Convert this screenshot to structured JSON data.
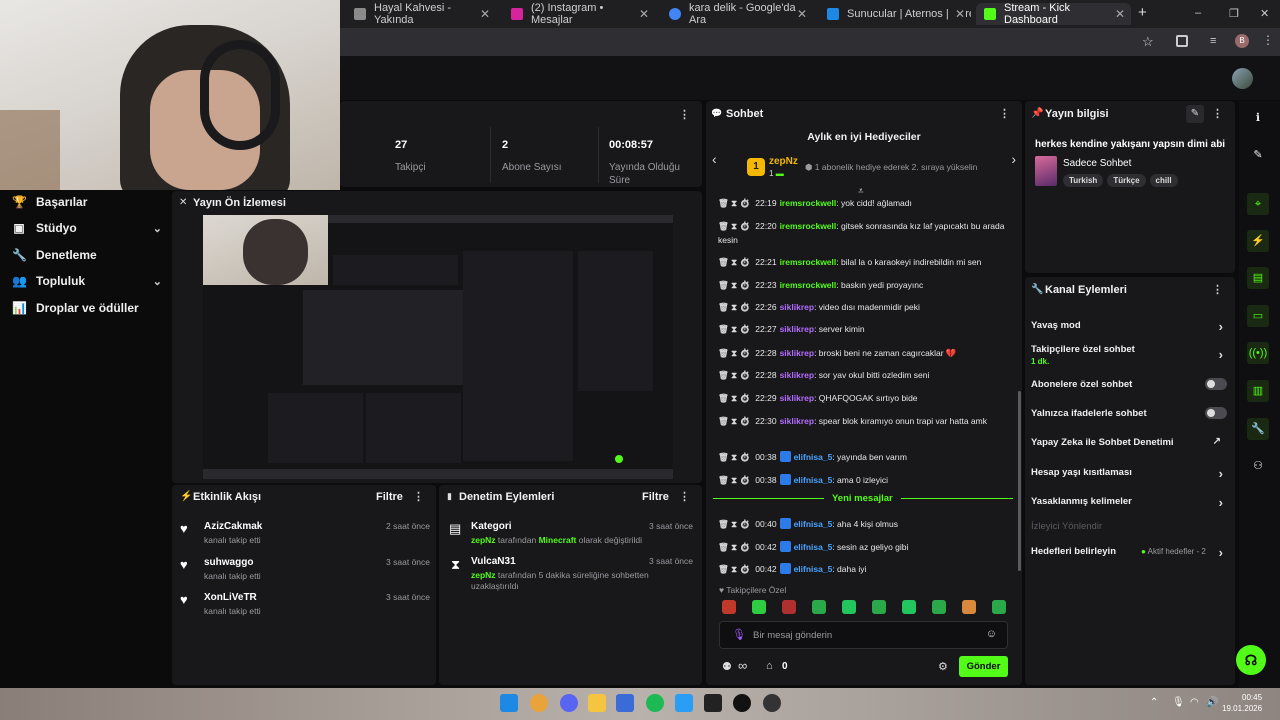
{
  "browser": {
    "tabs": [
      {
        "label": "Hayal Kahvesi - Yakında",
        "color": "#8a8a8a"
      },
      {
        "label": "(2) Instagram • Mesajlar",
        "color": "#d6249f"
      },
      {
        "label": "kara delik - Google'da Ara",
        "color": "#4285f4"
      },
      {
        "label": "Sunucular | Aternos | Ücretsiz M",
        "color": "#1e88e5"
      },
      {
        "label": "Stream - Kick Dashboard",
        "color": "#53fc18"
      }
    ],
    "new_tab": "+",
    "window_controls": [
      "–",
      "❐",
      "✕"
    ],
    "profile_initial": "B"
  },
  "sidebar": {
    "items": [
      {
        "label": "Başarılar",
        "icon": "trophy-icon",
        "glyph": "🏆",
        "chevron": false
      },
      {
        "label": "Stüdyo",
        "icon": "studio-icon",
        "glyph": "▣",
        "chevron": true
      },
      {
        "label": "Denetleme",
        "icon": "wrench-icon",
        "glyph": "🔧",
        "chevron": false
      },
      {
        "label": "Topluluk",
        "icon": "community-icon",
        "glyph": "👥",
        "chevron": true
      },
      {
        "label": "Droplar ve ödüller",
        "icon": "drops-icon",
        "glyph": "📊",
        "chevron": false
      }
    ]
  },
  "stats": [
    {
      "value": "27",
      "label": "Takipçi"
    },
    {
      "value": "2",
      "label": "Abone Sayısı"
    },
    {
      "value": "00:08:57",
      "label": "Yayında Olduğu Süre"
    }
  ],
  "preview": {
    "title": "Yayın Ön İzlemesi"
  },
  "activity": {
    "title": "Etkinlik Akışı",
    "filter": "Filtre",
    "items": [
      {
        "name": "AzizCakmak",
        "sub": "kanalı takip etti",
        "time": "2 saat önce"
      },
      {
        "name": "suhwaggo",
        "sub": "kanalı takip etti",
        "time": "3 saat önce"
      },
      {
        "name": "XonLiVeTR",
        "sub": "kanalı takip etti",
        "time": "3 saat önce"
      }
    ]
  },
  "moderation": {
    "title": "Denetim Eylemleri",
    "filter": "Filtre",
    "items": [
      {
        "name": "Kategori",
        "time": "3 saat önce",
        "by": "zepNz",
        "mid": " tarafından ",
        "hl": "Minecraft",
        "rest": " olarak değiştirildi"
      },
      {
        "name": "VulcaN31",
        "time": "3 saat önce",
        "by": "zepNz",
        "mid": " tarafından 5 dakika süreliğine sohbetten uzaklaştırıldı",
        "hl": "",
        "rest": ""
      }
    ]
  },
  "chat": {
    "title": "Sohbet",
    "gifters_title": "Aylık en iyi Hediyeciler",
    "top_gifter": {
      "rank": "1",
      "name": "zepNz",
      "count": "1"
    },
    "gifter_note": "1 abonelik hediye ederek 2. sıraya yükselin",
    "messages": [
      {
        "time": "22:19",
        "user": "iremsrockwell",
        "ucls": "u-green",
        "text": "yok cidd! ağlamadı"
      },
      {
        "time": "22:20",
        "user": "iremsrockwell",
        "ucls": "u-green",
        "text": "gitsek sonrasında kız laf yapıcaktı bu arada kesin"
      },
      {
        "time": "22:21",
        "user": "iremsrockwell",
        "ucls": "u-green",
        "text": "bilal la o karaokeyi indirebildin mi sen"
      },
      {
        "time": "22:23",
        "user": "iremsrockwell",
        "ucls": "u-green",
        "text": "baskın yedi proyayınc"
      },
      {
        "time": "22:26",
        "user": "siklikrep",
        "ucls": "u-purple",
        "text": "video dısı madenmidir peki"
      },
      {
        "time": "22:27",
        "user": "siklikrep",
        "ucls": "u-purple",
        "text": "server kimin"
      },
      {
        "time": "22:28",
        "user": "siklikrep",
        "ucls": "u-purple",
        "text": "broski beni ne zaman cagırcaklar 💔"
      },
      {
        "time": "22:28",
        "user": "siklikrep",
        "ucls": "u-purple",
        "text": "sor yav okul bitti ozledim seni"
      },
      {
        "time": "22:29",
        "user": "siklikrep",
        "ucls": "u-purple",
        "text": "QHAFQOGAK sırtıyo bide"
      },
      {
        "time": "22:30",
        "user": "siklikrep",
        "ucls": "u-purple",
        "text": "spear blok kıramıyo onun trapi var hatta amk"
      },
      {
        "time": "00:38",
        "user": "elifnisa_5",
        "ucls": "u-blue",
        "text": "yayında ben varım"
      },
      {
        "time": "00:38",
        "user": "elifnisa_5",
        "ucls": "u-blue",
        "text": "ama 0 izleyici"
      }
    ],
    "new_messages": "Yeni mesajlar",
    "new_msgs": [
      {
        "time": "00:40",
        "user": "elifnisa_5",
        "text": "aha 4 kişi olmus"
      },
      {
        "time": "00:42",
        "user": "elifnisa_5",
        "text": "sesin az geliyo gibi"
      },
      {
        "time": "00:42",
        "user": "elifnisa_5",
        "text": "daha iyi"
      }
    ],
    "followers_only": "Takipçilere Özel",
    "input_placeholder": "Bir mesaj gönderin",
    "count": "0",
    "send": "Gönder",
    "loop": "∞"
  },
  "stream_info": {
    "title": "Yayın bilgisi",
    "stream_title": "herkes kendine yakışanı yapsın dimi abi",
    "category": "Sadece Sohbet",
    "tags": [
      "Turkish",
      "Türkçe",
      "chill"
    ]
  },
  "channel_actions": {
    "title": "Kanal Eylemleri",
    "rows": [
      {
        "label": "Yavaş mod",
        "type": "chevron"
      },
      {
        "label": "Takipçilere özel sohbet",
        "sub": "1 dk.",
        "type": "chevron"
      },
      {
        "label": "Abonelere özel sohbet",
        "type": "toggle"
      },
      {
        "label": "Yalnızca ifadelerle sohbet",
        "type": "toggle"
      },
      {
        "label": "Yapay Zeka ile Sohbet Denetimi",
        "type": "external"
      },
      {
        "label": "Hesap yaşı kısıtlaması",
        "type": "chevron"
      },
      {
        "label": "Yasaklanmış kelimeler",
        "type": "chevron"
      },
      {
        "label": "İzleyici Yönlendir",
        "type": "disabled"
      },
      {
        "label": "Hedefleri belirleyin",
        "type": "goal",
        "goal_text": "Aktif hedefler - 2"
      }
    ]
  },
  "taskbar": {
    "time": "00:45",
    "date": "19.01.2026"
  },
  "colors": {
    "accent": "#53fc18",
    "panel": "#18181b",
    "bg": "#0b0b0c"
  }
}
